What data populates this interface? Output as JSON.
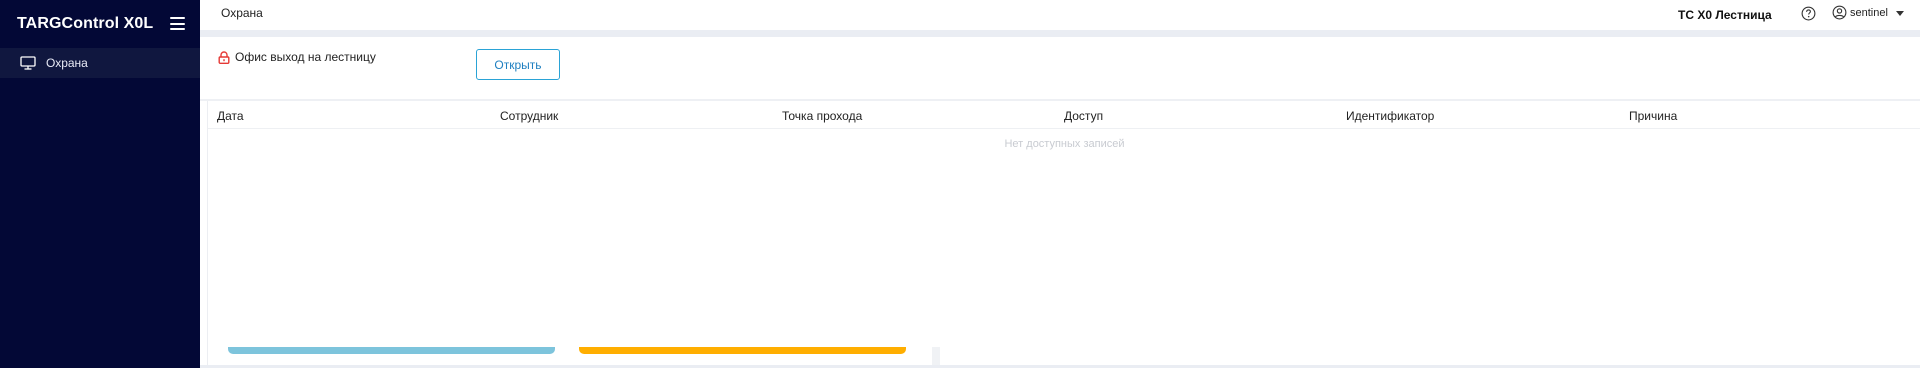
{
  "sidebar": {
    "brand": "TARGControl X0L",
    "items": [
      {
        "label": "Охрана",
        "icon": "monitor-icon"
      }
    ]
  },
  "header": {
    "breadcrumb": "Охрана",
    "device": "ТС X0 Лестница",
    "username": "sentinel"
  },
  "control": {
    "lock_label": "Офис выход на лестницу",
    "open_button": "Открыть"
  },
  "table": {
    "columns": [
      "Дата",
      "Сотрудник",
      "Точка прохода",
      "Доступ",
      "Идентификатор",
      "Причина"
    ],
    "empty_text": "Нет доступных записей"
  },
  "colors": {
    "sidebar_bg": "#030836",
    "accent": "#2aa3d6",
    "lock_red": "#e53935",
    "bar_blue": "#7dc4dc",
    "bar_orange": "#ffae00"
  }
}
